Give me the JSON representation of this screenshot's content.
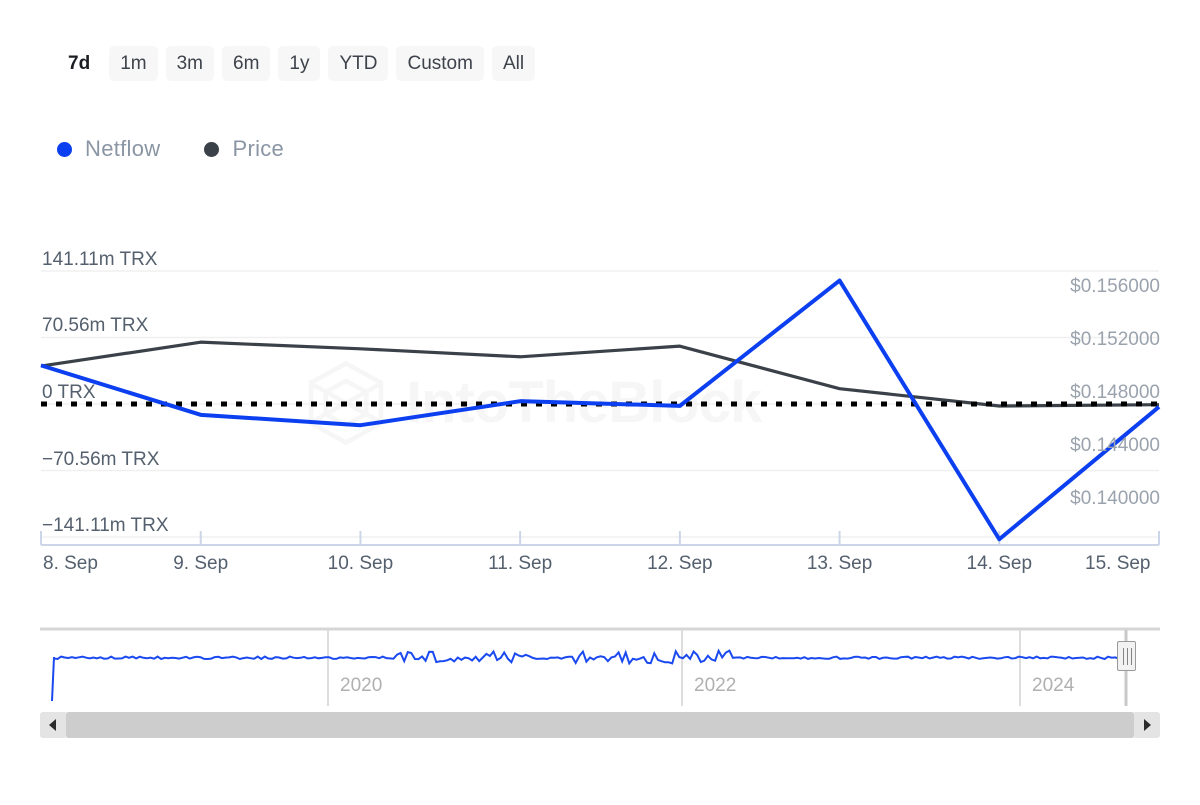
{
  "range_selector": {
    "options": [
      {
        "label": "7d",
        "selected": true
      },
      {
        "label": "1m",
        "selected": false
      },
      {
        "label": "3m",
        "selected": false
      },
      {
        "label": "6m",
        "selected": false
      },
      {
        "label": "1y",
        "selected": false
      },
      {
        "label": "YTD",
        "selected": false
      },
      {
        "label": "Custom",
        "selected": false
      },
      {
        "label": "All",
        "selected": false
      }
    ]
  },
  "legend": {
    "items": [
      {
        "label": "Netflow",
        "color": "#0b3ff0",
        "icon": "series-dot-icon"
      },
      {
        "label": "Price",
        "color": "#3b4148",
        "icon": "series-dot-icon"
      }
    ]
  },
  "watermark": {
    "text": "IntoTheBlock",
    "logo": "intotheblock-hexagon-logo"
  },
  "navigator": {
    "year_labels": [
      "2020",
      "2022",
      "2024"
    ],
    "handle_right": "navigator-right-handle",
    "scroll_left": "scroll-left-arrow",
    "scroll_right": "scroll-right-arrow"
  },
  "chart_data": {
    "type": "line",
    "title": "",
    "xlabel": "",
    "grid": true,
    "legend_position": "top-left",
    "x": [
      "8. Sep",
      "9. Sep",
      "10. Sep",
      "11. Sep",
      "12. Sep",
      "13. Sep",
      "14. Sep",
      "15. Sep"
    ],
    "xticks": [
      "8. Sep",
      "9. Sep",
      "10. Sep",
      "11. Sep",
      "12. Sep",
      "13. Sep",
      "14. Sep",
      "15. Sep"
    ],
    "axes": [
      {
        "id": "netflow",
        "side": "left",
        "ylabel": "",
        "unit": "TRX",
        "ylim": [
          -141.11,
          141.11
        ],
        "tick_labels": [
          "141.11m TRX",
          "70.56m TRX",
          "0 TRX",
          "−70.56m TRX",
          "−141.11m TRX"
        ],
        "tick_values": [
          141.11,
          70.56,
          0,
          -70.56,
          -141.11
        ]
      },
      {
        "id": "price",
        "side": "right",
        "ylabel": "",
        "unit": "USD",
        "ylim": [
          0.138,
          0.158
        ],
        "tick_labels": [
          "$0.156000",
          "$0.152000",
          "$0.148000",
          "$0.144000",
          "$0.140000"
        ],
        "tick_values": [
          0.156,
          0.152,
          0.148,
          0.144,
          0.14
        ]
      }
    ],
    "series": [
      {
        "name": "Netflow",
        "axis": "netflow",
        "color": "#0b3ff0",
        "unit": "m TRX",
        "values": [
          41.0,
          -11.5,
          -22.5,
          3.0,
          -2.0,
          131.0,
          -143.5,
          -3.0
        ]
      },
      {
        "name": "Price",
        "axis": "price",
        "color": "#3b4148",
        "unit": "USD",
        "values": [
          0.15085,
          0.15265,
          0.15215,
          0.15155,
          0.15235,
          0.14915,
          0.14785,
          0.14795
        ]
      }
    ],
    "zero_line": {
      "value": 0,
      "axis": "netflow",
      "style": "dotted",
      "color": "#000000"
    },
    "navigator_series": {
      "name": "Netflow",
      "color": "#1a49f0",
      "xticks": [
        "2020",
        "2022",
        "2024"
      ]
    }
  }
}
